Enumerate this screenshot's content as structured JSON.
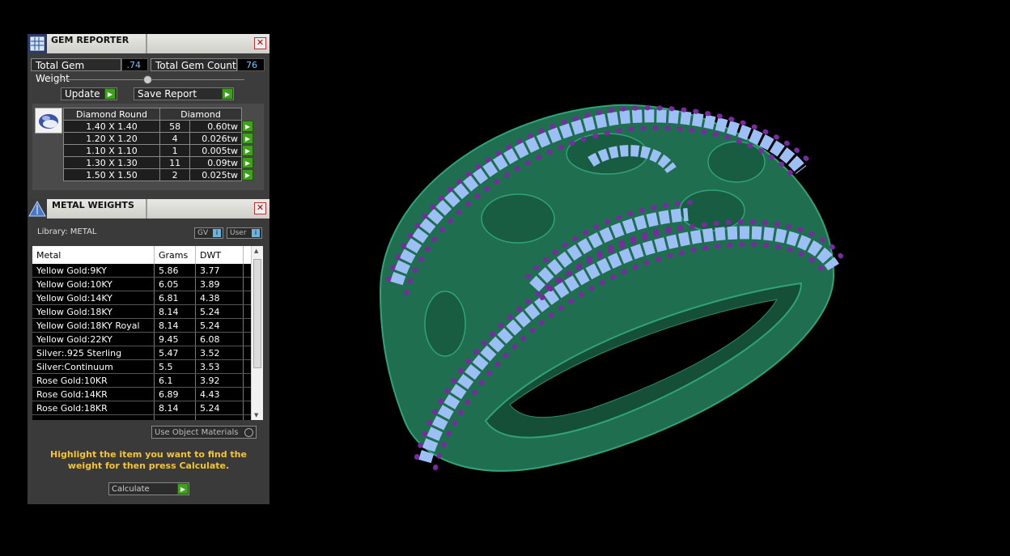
{
  "gem_reporter": {
    "title": "GEM REPORTER",
    "close": "✕",
    "total_weight_label": "Total Gem Weight",
    "total_weight_value": ".74",
    "total_count_label": "Total Gem Count",
    "total_count_value": "76",
    "update_label": "Update",
    "save_report_label": "Save Report",
    "table": {
      "headers": [
        "Diamond Round",
        "Diamond"
      ],
      "rows": [
        {
          "size": "1.40 X 1.40",
          "count": "58",
          "tw": "0.60tw"
        },
        {
          "size": "1.20 X 1.20",
          "count": "4",
          "tw": "0.026tw"
        },
        {
          "size": "1.10 X 1.10",
          "count": "1",
          "tw": "0.005tw"
        },
        {
          "size": "1.30 X 1.30",
          "count": "11",
          "tw": "0.09tw"
        },
        {
          "size": "1.50 X 1.50",
          "count": "2",
          "tw": "0.025tw"
        }
      ]
    }
  },
  "metal_weights": {
    "title": "METAL WEIGHTS",
    "close": "✕",
    "library_label": "Library: METAL",
    "gv_label": "GV",
    "user_label": "User",
    "columns": [
      "Metal",
      "Grams",
      "DWT"
    ],
    "rows": [
      {
        "metal": "Yellow Gold:9KY",
        "grams": "5.86",
        "dwt": "3.77"
      },
      {
        "metal": "Yellow Gold:10KY",
        "grams": "6.05",
        "dwt": "3.89"
      },
      {
        "metal": "Yellow Gold:14KY",
        "grams": "6.81",
        "dwt": "4.38"
      },
      {
        "metal": "Yellow Gold:18KY",
        "grams": "8.14",
        "dwt": "5.24"
      },
      {
        "metal": "Yellow Gold:18KY Royal",
        "grams": "8.14",
        "dwt": "5.24"
      },
      {
        "metal": "Yellow Gold:22KY",
        "grams": "9.45",
        "dwt": "6.08"
      },
      {
        "metal": "Silver:.925 Sterling",
        "grams": "5.47",
        "dwt": "3.52"
      },
      {
        "metal": "Silver:Continuum",
        "grams": "5.5",
        "dwt": "3.53"
      },
      {
        "metal": "Rose Gold:10KR",
        "grams": "6.1",
        "dwt": "3.92"
      },
      {
        "metal": "Rose Gold:14KR",
        "grams": "6.89",
        "dwt": "4.43"
      },
      {
        "metal": "Rose Gold:18KR",
        "grams": "8.14",
        "dwt": "5.24"
      }
    ],
    "use_object_materials_label": "Use Object Materials",
    "hint": "Highlight the item you want to find the weight for then press Calculate.",
    "calculate_label": "Calculate"
  },
  "colors": {
    "metal_green": "#1f6e4f",
    "gem_blue": "#8fb6f2",
    "prong_purple": "#7a2aa0",
    "hint_yellow": "#f5c431",
    "value_blue": "#6bc6ff",
    "go_green": "#3da11a"
  },
  "icons": {
    "gem_reporter": "report-grid-icon",
    "metal_weights": "scale-icon",
    "go": "play-arrow-icon"
  }
}
